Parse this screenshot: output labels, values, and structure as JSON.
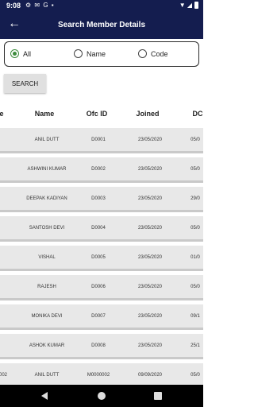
{
  "status_bar": {
    "time": "9:08",
    "notification_icons": "⚙ ✉ G ▪",
    "right_icons": "▼ ◢"
  },
  "app_bar": {
    "title": "Search Member Details",
    "back_icon": "←"
  },
  "filter": {
    "options": [
      "All",
      "Name",
      "Code"
    ],
    "selected": "All"
  },
  "search_button": "SEARCH",
  "table": {
    "headers": [
      "e",
      "Name",
      "Ofc ID",
      "Joined",
      "DC"
    ],
    "rows": [
      {
        "c0": "",
        "name": "ANIL DUTT",
        "ofc_id": "D0001",
        "joined": "23/05/2020",
        "dc": "05/0"
      },
      {
        "c0": "",
        "name": "ASHWINI KUMAR",
        "ofc_id": "D0002",
        "joined": "23/05/2020",
        "dc": "05/0"
      },
      {
        "c0": "",
        "name": "DEEPAK KADIYAN",
        "ofc_id": "D0003",
        "joined": "23/05/2020",
        "dc": "29/0"
      },
      {
        "c0": "",
        "name": "SANTOSH DEVI",
        "ofc_id": "D0004",
        "joined": "23/05/2020",
        "dc": "05/0"
      },
      {
        "c0": "",
        "name": "VISHAL",
        "ofc_id": "D0005",
        "joined": "23/05/2020",
        "dc": "01/0"
      },
      {
        "c0": "",
        "name": "RAJESH",
        "ofc_id": "D0006",
        "joined": "23/05/2020",
        "dc": "05/0"
      },
      {
        "c0": "",
        "name": "MONIKA DEVI",
        "ofc_id": "D0007",
        "joined": "23/05/2020",
        "dc": "09/1"
      },
      {
        "c0": "",
        "name": "ASHOK KUMAR",
        "ofc_id": "D0008",
        "joined": "23/05/2020",
        "dc": "25/1"
      },
      {
        "c0": "002",
        "name": "ANIL DUTT",
        "ofc_id": "M0000002",
        "joined": "09/09/2020",
        "dc": "05/0"
      }
    ]
  },
  "colors": {
    "primary": "#141d4f",
    "radio_selected": "#3c8c3c",
    "row_bg": "#e8e8e8"
  }
}
